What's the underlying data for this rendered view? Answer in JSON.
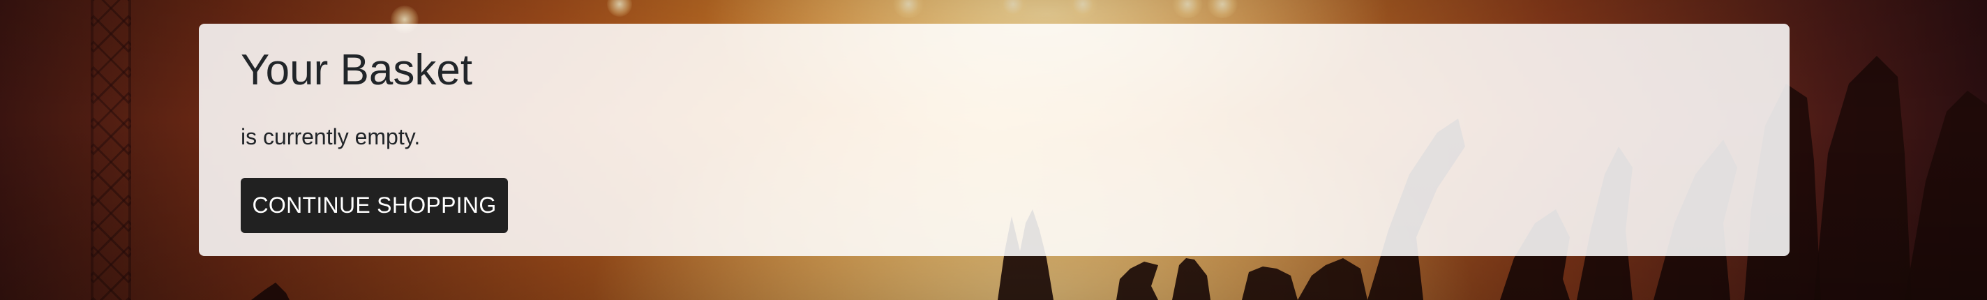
{
  "basket": {
    "title": "Your Basket",
    "message": "is currently empty.",
    "continue_label": "CONTINUE SHOPPING"
  },
  "background": {
    "description_icon": "concert-crowd-background",
    "accent": "#e8a440"
  }
}
